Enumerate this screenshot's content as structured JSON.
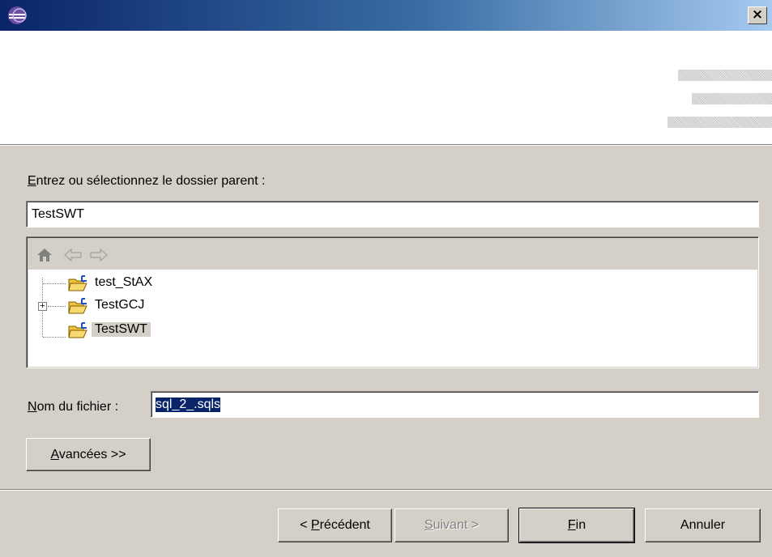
{
  "window": {
    "close_label": "×"
  },
  "form": {
    "parent_folder_label": "ntrez ou sélectionnez le dossier parent :",
    "parent_folder_mnemonic": "E",
    "parent_folder_value": "TestSWT",
    "file_name_label": "om du fichier :",
    "file_name_mnemonic": "N",
    "file_name_value": "sql_2_.sqls",
    "advanced_button": {
      "mnemonic": "A",
      "rest": "vancées >>"
    }
  },
  "tree": {
    "toolbar_icons": [
      "home-icon",
      "back-arrow-icon",
      "forward-arrow-icon"
    ],
    "items": [
      {
        "label": "test_StAX",
        "expandable": false,
        "selected": false
      },
      {
        "label": "TestGCJ",
        "expandable": true,
        "selected": false
      },
      {
        "label": "TestSWT",
        "expandable": false,
        "selected": true
      }
    ]
  },
  "buttons": {
    "previous": {
      "prefix": "< ",
      "mnemonic": "P",
      "rest": "récédent",
      "enabled": true
    },
    "next": {
      "mnemonic": "S",
      "rest": "uivant >",
      "enabled": false
    },
    "finish": {
      "mnemonic": "F",
      "rest": "in",
      "enabled": true
    },
    "cancel": {
      "label": "Annuler",
      "enabled": true
    }
  },
  "colors": {
    "dialog_bg": "#d4d0c8",
    "title_gradient_start": "#0a246a",
    "title_gradient_end": "#a6caf0",
    "selection": "#0a246a"
  }
}
